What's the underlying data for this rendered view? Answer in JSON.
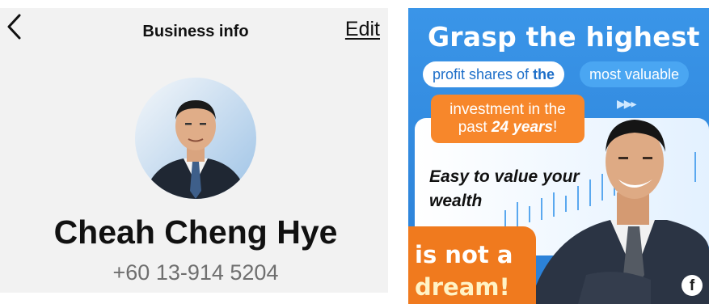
{
  "header": {
    "title": "Business info",
    "edit_label": "Edit"
  },
  "profile": {
    "name": "Cheah Cheng Hye",
    "phone": "+60 13-914 5204"
  },
  "icons": {
    "back": "chevron-left-icon",
    "facebook": "facebook-icon"
  },
  "ad": {
    "headline": "Grasp the highest",
    "pill_left_pre": "profit shares of ",
    "pill_left_bold": "the",
    "pill_right": "most valuable",
    "box_line1": "investment in the",
    "box_line2_pre": "past ",
    "box_line2_bold": "24 years",
    "box_line2_post": "!",
    "easy_line1": "Easy to value your",
    "easy_line2": "wealth",
    "dream_line1": "is not a",
    "dream_line2": "dream!",
    "fb_glyph": "f"
  },
  "colors": {
    "ad_blue": "#2e8ae0",
    "ad_orange": "#f7872b",
    "text_gray": "#6f6f6f"
  }
}
